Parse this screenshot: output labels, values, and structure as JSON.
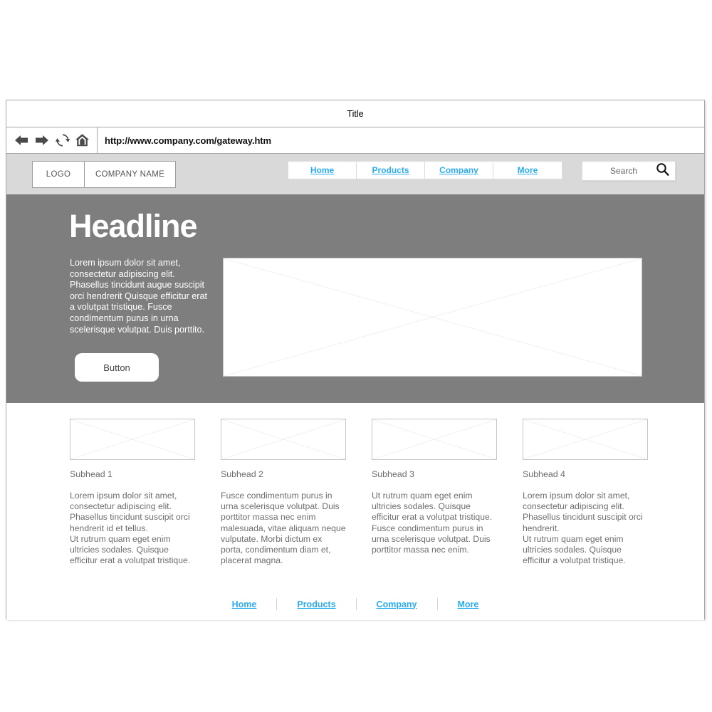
{
  "browser": {
    "title": "Title",
    "url": "http://www.company.com/gateway.htm",
    "controls": [
      {
        "name": "back-icon",
        "label": "Back"
      },
      {
        "name": "forward-icon",
        "label": "Forward"
      },
      {
        "name": "reload-icon",
        "label": "Reload"
      },
      {
        "name": "home-icon",
        "label": "Home"
      }
    ]
  },
  "header": {
    "logo": "LOGO",
    "company_name": "COMPANY NAME",
    "nav": [
      {
        "label": "Home"
      },
      {
        "label": "Products"
      },
      {
        "label": "Company"
      },
      {
        "label": "More"
      }
    ],
    "search": {
      "placeholder": "Search",
      "icon": "search-icon"
    }
  },
  "hero": {
    "headline": "Headline",
    "body": "Lorem ipsum dolor sit amet, consectetur adipiscing elit. Phasellus tincidunt augue suscipit orci hendrerit Quisque efficitur erat a volutpat tristique. Fusce condimentum purus in urna scelerisque volutpat. Duis porttito.",
    "button_label": "Button",
    "image_placeholder": "image-placeholder"
  },
  "content": {
    "columns": [
      {
        "subhead": "Subhead 1",
        "body": "Lorem ipsum dolor sit amet, consectetur adipiscing elit. Phasellus tincidunt suscipit orci hendrerit id et tellus.\nUt rutrum quam eget enim ultricies sodales. Quisque efficitur erat a volutpat tristique."
      },
      {
        "subhead": "Subhead 2",
        "body": " Fusce condimentum purus in urna scelerisque volutpat. Duis porttitor massa nec enim malesuada, vitae aliquam neque vulputate. Morbi dictum ex porta, condimentum diam et, placerat magna."
      },
      {
        "subhead": "Subhead 3",
        "body": "Ut rutrum quam eget enim ultricies sodales. Quisque efficitur erat a volutpat tristique. Fusce condimentum purus in urna scelerisque volutpat. Duis porttitor massa nec enim."
      },
      {
        "subhead": "Subhead 4",
        "body": "Lorem ipsum dolor sit amet, consectetur adipiscing elit. Phasellus tincidunt suscipit orci hendrerit.\nUt rutrum quam eget enim ultricies sodales. Quisque efficitur a volutpat tristique."
      }
    ]
  },
  "footer": {
    "links": [
      {
        "label": "Home"
      },
      {
        "label": "Products"
      },
      {
        "label": "Company"
      },
      {
        "label": "More"
      }
    ]
  },
  "colors": {
    "link": "#2badf1",
    "hero_background": "#7e7e7e",
    "header_background": "#d9d9d9",
    "text_muted": "#6d6d6d"
  }
}
